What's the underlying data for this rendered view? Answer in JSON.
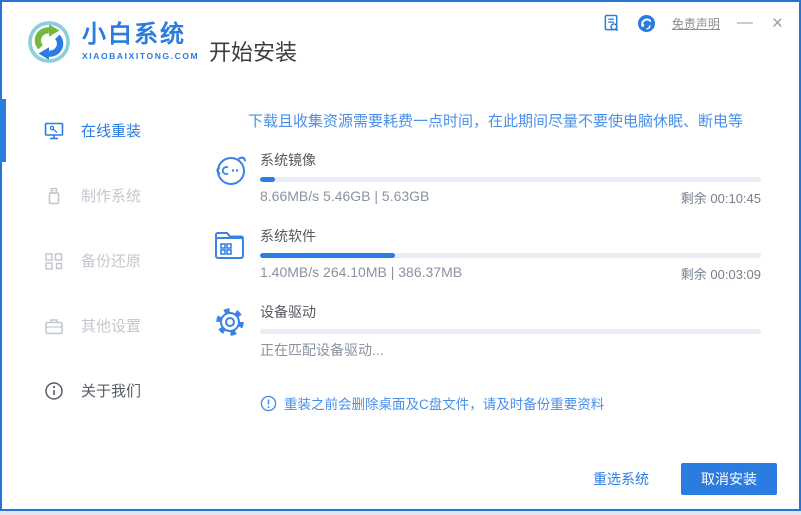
{
  "colors": {
    "accent": "#2b7ce0",
    "window_border": "#2574d4",
    "warning_text": "#4a90e8",
    "bar_track": "#e8edf6",
    "inactive_gray": "#c3c7ce"
  },
  "brand": {
    "name": "小白系统",
    "domain": "XIAOBAIXITONG.COM",
    "logo_icon": "recycle-arrows-logo"
  },
  "header": {
    "title": "开始安装"
  },
  "titlebar": {
    "log_icon": "document-search-icon",
    "support_icon": "headset-icon",
    "disclaimer": "免责声明",
    "minimize": "—",
    "close": "×"
  },
  "sidebar": {
    "items": [
      {
        "label": "在线重装",
        "icon": "monitor-icon",
        "active": true
      },
      {
        "label": "制作系统",
        "icon": "usb-drive-icon",
        "active": false
      },
      {
        "label": "备份还原",
        "icon": "blocks-icon",
        "active": false
      },
      {
        "label": "其他设置",
        "icon": "briefcase-icon",
        "active": false
      },
      {
        "label": "关于我们",
        "icon": "info-circle-icon",
        "active": false
      }
    ]
  },
  "main": {
    "warning": "下载且收集资源需要耗费一点时间，在此期间尽量不要使电脑休眠、断电等",
    "tasks": [
      {
        "label": "系统镜像",
        "icon": "mascot-face-icon",
        "status": "8.66MB/s 5.46GB | 5.63GB",
        "remaining": "剩余 00:10:45",
        "progress": 3
      },
      {
        "label": "系统软件",
        "icon": "folder-grid-icon",
        "status": "1.40MB/s 264.10MB | 386.37MB",
        "remaining": "剩余 00:03:09",
        "progress": 27
      },
      {
        "label": "设备驱动",
        "icon": "gear-icon",
        "status": "正在匹配设备驱动...",
        "remaining": "",
        "progress": 0
      }
    ],
    "notice": "重装之前会删除桌面及C盘文件，请及时备份重要资料",
    "footer": {
      "reselect": "重选系统",
      "cancel": "取消安装"
    }
  }
}
